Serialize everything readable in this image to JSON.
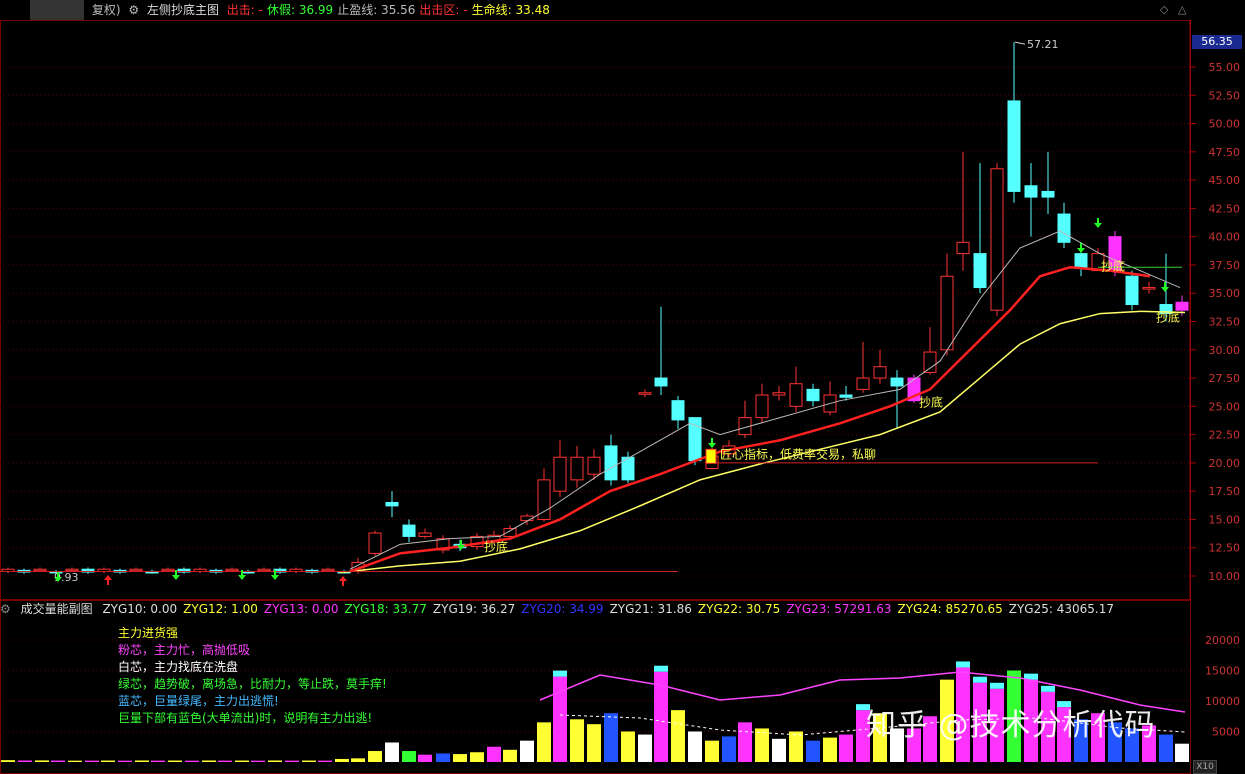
{
  "main_title": {
    "prefix": "复权)",
    "indicator": "左侧抄底主图",
    "items": [
      {
        "label": "出击:",
        "value": "-",
        "color": "#ff3333"
      },
      {
        "label": "休假:",
        "value": "36.99",
        "color": "#33ff33"
      },
      {
        "label": "止盈线:",
        "value": "35.56",
        "color": "#bbbbbb"
      },
      {
        "label": "出击区:",
        "value": "-",
        "color": "#ff3333"
      },
      {
        "label": "生命线:",
        "value": "33.48",
        "color": "#ffff33"
      }
    ]
  },
  "price_axis": {
    "current_price": "56.35",
    "ticks": [
      "55.00",
      "52.50",
      "50.00",
      "47.50",
      "45.00",
      "42.50",
      "40.00",
      "37.50",
      "35.00",
      "32.50",
      "30.00",
      "27.50",
      "25.00",
      "22.50",
      "20.00",
      "17.50",
      "15.00",
      "12.50",
      "10.00"
    ]
  },
  "annotations": {
    "high_label": "57.21",
    "low_label": "9.93",
    "dip_labels": [
      "抄底",
      "抄底",
      "抄底",
      "抄底"
    ],
    "chat_note": "匠心指标，低费率交易，私聊"
  },
  "sub_title": {
    "indicator": "成交量能副图",
    "items": [
      {
        "label": "ZYG10:",
        "value": "0.00",
        "color": "#dddddd"
      },
      {
        "label": "ZYG12:",
        "value": "1.00",
        "color": "#ffff33"
      },
      {
        "label": "ZYG13:",
        "value": "0.00",
        "color": "#ff33ff"
      },
      {
        "label": "ZYG18:",
        "value": "33.77",
        "color": "#33ff33"
      },
      {
        "label": "ZYG19:",
        "value": "36.27",
        "color": "#dddddd"
      },
      {
        "label": "ZYG20:",
        "value": "34.99",
        "color": "#3333ff"
      },
      {
        "label": "ZYG21:",
        "value": "31.86",
        "color": "#dddddd"
      },
      {
        "label": "ZYG22:",
        "value": "30.75",
        "color": "#ffff33"
      },
      {
        "label": "ZYG23:",
        "value": "57291.63",
        "color": "#ff33ff"
      },
      {
        "label": "ZYG24:",
        "value": "85270.65",
        "color": "#ffff33"
      },
      {
        "label": "ZYG25:",
        "value": "43065.17",
        "color": "#dddddd"
      }
    ]
  },
  "volume_axis": {
    "ticks": [
      "20000",
      "15000",
      "10000",
      "5000"
    ],
    "multiplier": "X10"
  },
  "legend_lines": [
    {
      "text": "主力进货强",
      "color": "#ffff33"
    },
    {
      "text": "粉芯，主力忙，高抛低吸",
      "color": "#ff44ff"
    },
    {
      "text": "白芯，主力找底在洗盘",
      "color": "#ffffff"
    },
    {
      "text": "绿芯，趋势破，离场急，比耐力，等止跌，莫手痒!",
      "color": "#33ff33"
    },
    {
      "text": "蓝芯，巨量绿尾，主力出逃慌!",
      "color": "#44bbff"
    },
    {
      "text": "巨量下部有蓝色(大单流出)时，说明有主力出逃!",
      "color": "#33ff33"
    }
  ],
  "watermark": "知乎 @技术分析代码",
  "colors": {
    "up": "#ff3333",
    "down": "#55ffff",
    "pink": "#ff33ff",
    "life_line": "#ffff66",
    "ma_red": "#ff2020",
    "ma_gray": "#bbbbbb"
  }
}
